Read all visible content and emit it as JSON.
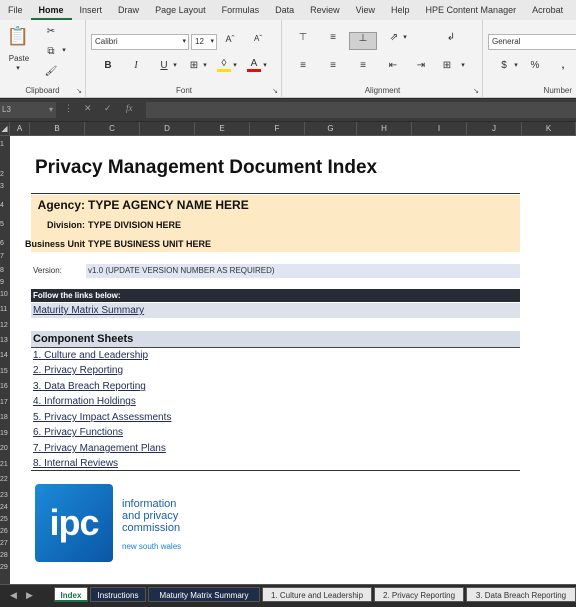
{
  "ribbon": {
    "tabs": [
      "File",
      "Home",
      "Insert",
      "Draw",
      "Page Layout",
      "Formulas",
      "Data",
      "Review",
      "View",
      "Help",
      "HPE Content Manager",
      "Acrobat"
    ],
    "active_tab": "Home",
    "clipboard": {
      "label": "Clipboard",
      "paste": "Paste"
    },
    "font": {
      "label": "Font",
      "name": "Calibri",
      "size": "12",
      "bold": "B",
      "italic": "I",
      "underline": "U"
    },
    "alignment": {
      "label": "Alignment"
    },
    "number": {
      "label": "Number",
      "format": "General",
      "currency": "$",
      "percent": "%"
    }
  },
  "formula_bar": {
    "name_box": "L3",
    "fx": "fx"
  },
  "columns": [
    "A",
    "B",
    "C",
    "D",
    "E",
    "F",
    "G",
    "H",
    "I",
    "J",
    "K"
  ],
  "rows": [
    "1",
    "2",
    "3",
    "4",
    "5",
    "6",
    "7",
    "8",
    "9",
    "10",
    "11",
    "12",
    "13",
    "14",
    "15",
    "16",
    "17",
    "18",
    "19",
    "20",
    "21",
    "22",
    "23",
    "24",
    "25",
    "26",
    "27",
    "28",
    "29"
  ],
  "doc": {
    "title": "Privacy Management Document Index",
    "agency_label": "Agency:",
    "agency_value": "TYPE AGENCY NAME HERE",
    "division_label": "Division:",
    "division_value": "TYPE DIVISION HERE",
    "business_label": "Business Unit",
    "business_value": "TYPE BUSINESS UNIT HERE",
    "version_label": "Version:",
    "version_value": "v1.0 (UPDATE VERSION NUMBER AS REQUIRED)",
    "follow_header": "Follow the links below:",
    "maturity_link": "Maturity Matrix Summary",
    "component_header": "Component Sheets",
    "components": [
      "1. Culture and Leadership",
      "2. Privacy Reporting",
      "3. Data Breach Reporting",
      "4. Information Holdings",
      "5. Privacy Impact Assessments",
      "6. Privacy Functions",
      "7. Privacy Management Plans",
      "8. Internal Reviews"
    ]
  },
  "logo": {
    "mark": "ipc",
    "line1": "information",
    "line2": "and privacy",
    "line3": "commission",
    "sub": "new south wales"
  },
  "sheet_tabs": [
    "Index",
    "Instructions",
    "Maturity Matrix Summary",
    "1. Culture and Leadership",
    "2. Privacy Reporting",
    "3. Data Breach Reporting"
  ],
  "colors": {
    "accent": "#1e7145",
    "band": "#fde9c3",
    "dark_header": "#262b35"
  }
}
